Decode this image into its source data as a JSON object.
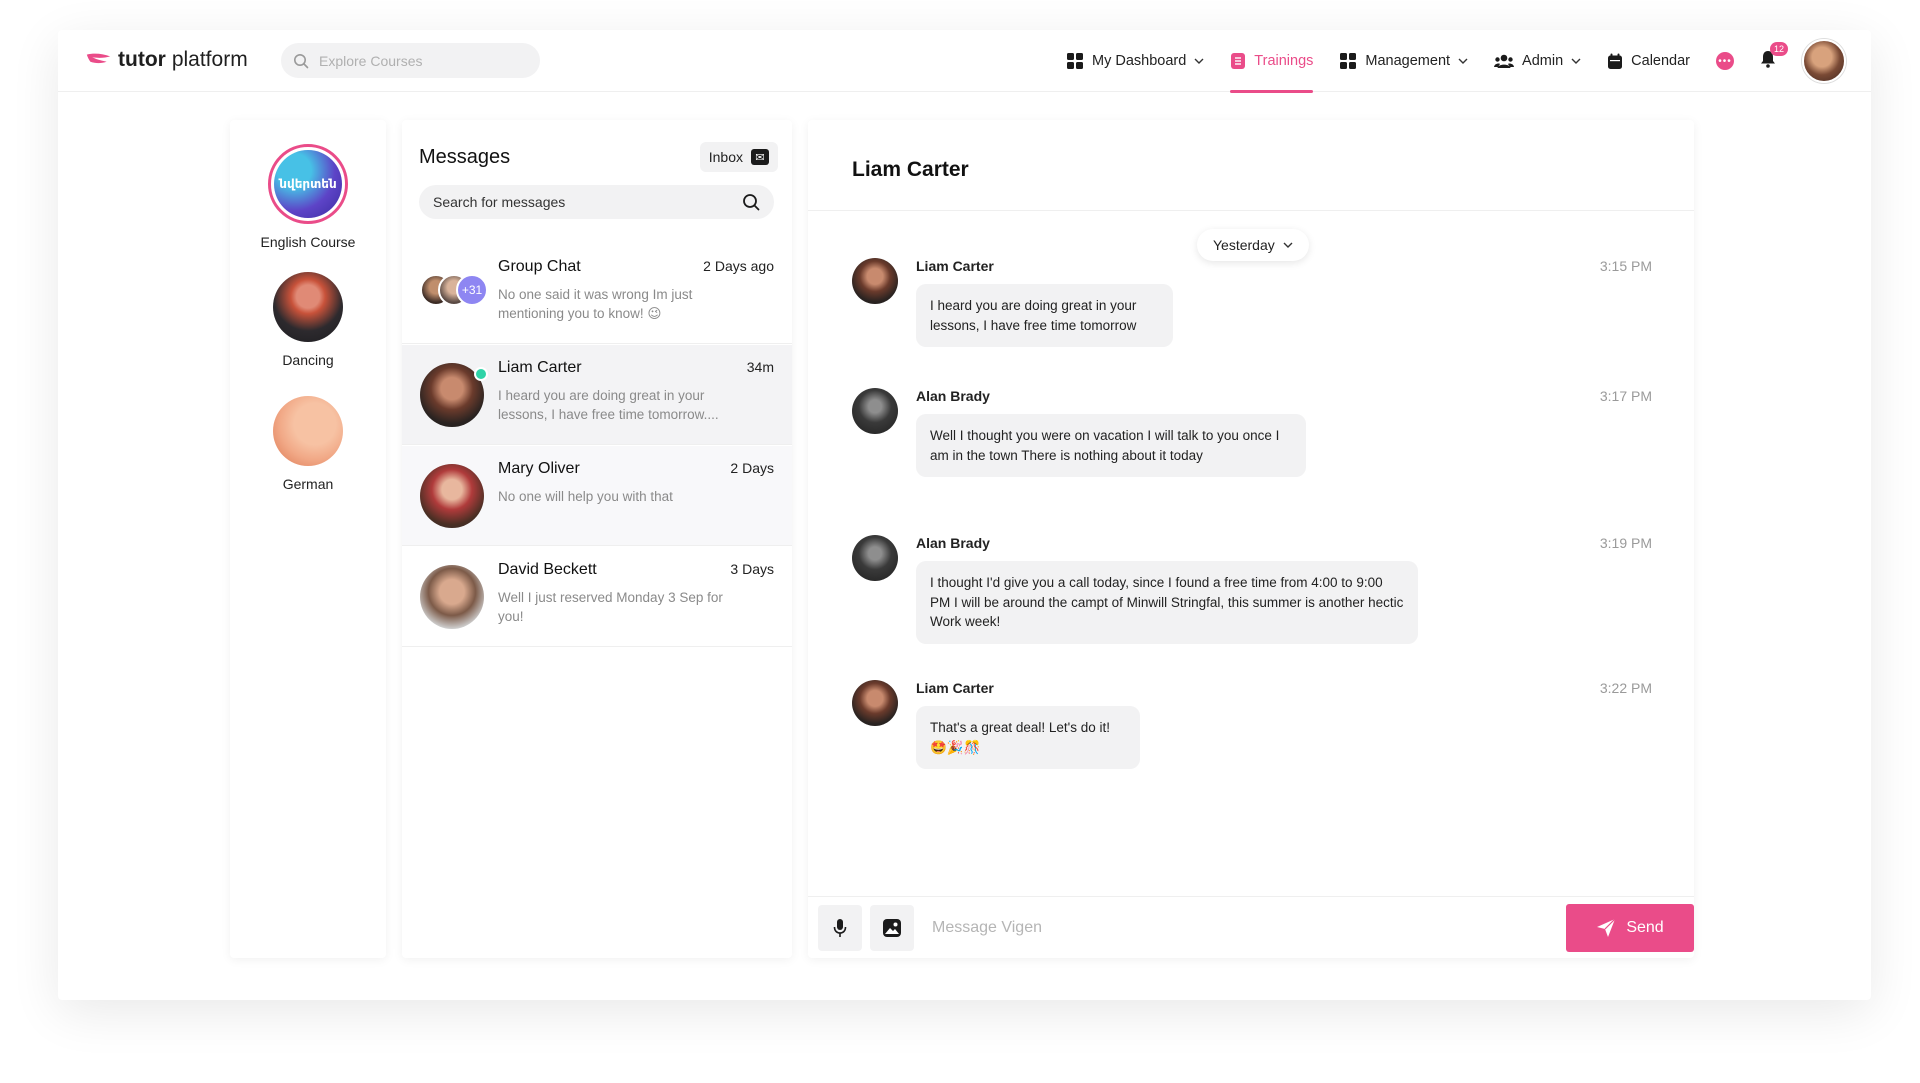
{
  "header": {
    "brand": {
      "bold": "tutor",
      "light": "platform"
    },
    "search": {
      "placeholder": "Explore Courses"
    },
    "nav": [
      {
        "label": "My Dashboard",
        "icon": "grid-icon",
        "has_dropdown": true,
        "active": false
      },
      {
        "label": "Trainings",
        "icon": "document-icon",
        "has_dropdown": false,
        "active": true
      },
      {
        "label": "Management",
        "icon": "grid-icon",
        "has_dropdown": true,
        "active": false
      },
      {
        "label": "Admin",
        "icon": "users-icon",
        "has_dropdown": true,
        "active": false
      },
      {
        "label": "Calendar",
        "icon": "calendar-icon",
        "has_dropdown": false,
        "active": false
      }
    ],
    "notifications_count": "12",
    "accent_color": "#ea4c89"
  },
  "courses": [
    {
      "label": "English Course",
      "image_text": "նվերտեն"
    },
    {
      "label": "Dancing"
    },
    {
      "label": "German"
    }
  ],
  "messages_panel": {
    "title": "Messages",
    "inbox_label": "Inbox",
    "search_placeholder": "Search for messages",
    "conversations": [
      {
        "name": "Group Chat",
        "time": "2 Days ago",
        "snippet": "No one said it was wrong Im just mentioning you to know! 😉",
        "extra_members": "+31"
      },
      {
        "name": "Liam Carter",
        "time": "34m",
        "snippet": "I heard you are doing great in your lessons, I have free time tomorrow....",
        "online": true,
        "selected": true
      },
      {
        "name": "Mary Oliver",
        "time": "2 Days",
        "snippet": "No one will help you with that"
      },
      {
        "name": "David Beckett",
        "time": "3 Days",
        "snippet": "Well I just reserved Monday 3 Sep for you!"
      }
    ]
  },
  "chat": {
    "title": "Liam Carter",
    "day_label": "Yesterday",
    "messages": [
      {
        "sender": "Liam Carter",
        "time": "3:15 PM",
        "text": "I heard you are doing great in your lessons, I have free time tomorrow"
      },
      {
        "sender": "Alan Brady",
        "time": "3:17 PM",
        "text": "Well I thought you were on vacation I will talk to you once I am in the town There is nothing about it today"
      },
      {
        "sender": "Alan Brady",
        "time": "3:19 PM",
        "text": "I thought I'd give you a call today, since I found a free time from 4:00 to 9:00 PM I will be around the campt of Minwill Stringfal, this summer is another hectic Work week!"
      },
      {
        "sender": "Liam Carter",
        "time": "3:22 PM",
        "text": "That's a great deal! Let's do it! 🤩🎉🎊"
      }
    ],
    "composer": {
      "placeholder": "Message Vigen",
      "send_label": "Send"
    }
  }
}
